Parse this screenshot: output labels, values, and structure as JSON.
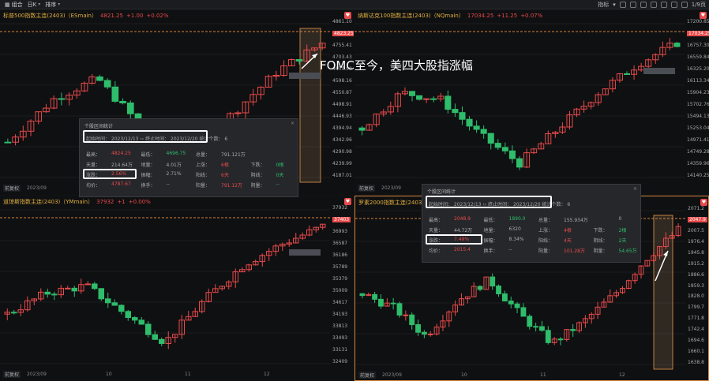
{
  "toolbar": {
    "group": "组合",
    "period": "日K",
    "sort": "排序",
    "indicator": "指标",
    "page": "1/9页"
  },
  "panels": [
    {
      "title": "标普500指数主连(2403)（ESmain）",
      "price": "4821.25",
      "change": "+1.00",
      "pct": "+0.02%",
      "y": [
        "4861.10",
        "4823.25",
        "4755.41",
        "4703.43",
        "4650.90",
        "4598.16",
        "4550.87",
        "4498.91",
        "4446.93",
        "4394.94",
        "4342.96",
        "4290.98",
        "4239.99",
        "4187.01"
      ],
      "fq": "前复权",
      "x": [
        "2023/09"
      ],
      "up": true
    },
    {
      "title": "纳斯达克100指数主连(2403)（NQmain）",
      "price": "17034.25",
      "change": "+11.25",
      "pct": "+0.07%",
      "y": [
        "17200.85",
        "17034.25",
        "16757.30",
        "16559.84",
        "16325.20",
        "16113.34",
        "15904.23",
        "15702.76",
        "15494.13",
        "15253.04",
        "14971.41",
        "14749.28",
        "14359.96",
        "14140.25"
      ],
      "fq": "前复权",
      "x": [
        "2023/09"
      ],
      "up": true
    },
    {
      "title": "道琼斯指数主连(2403)（YMmain）",
      "price": "37932",
      "change": "+1",
      "pct": "+0.00%",
      "y": [
        "37932",
        "37403",
        "36993",
        "36587",
        "36186",
        "35789",
        "35379",
        "35009",
        "34617",
        "34193",
        "33813",
        "33493",
        "33131",
        "32409"
      ],
      "fq": "前复权",
      "x": [
        "2023/09",
        "10",
        "11",
        "12"
      ],
      "up": true
    },
    {
      "title": "罗素2000指数主连(2403)（R",
      "price": "2047.9",
      "change": "",
      "pct": "",
      "y": [
        "2071.2",
        "2047.9",
        "2007.5",
        "1976.4",
        "1945.8",
        "1915.2",
        "1886.6",
        "1859.3",
        "1828.0",
        "1799.7",
        "1771.8",
        "1742.4",
        "1694.6",
        "1660.1",
        "1638.8"
      ],
      "fq": "前复权",
      "x": [
        "2023/09",
        "10",
        "11",
        "12"
      ],
      "up": true
    }
  ],
  "dialogs": [
    {
      "title": "个股区间统计",
      "start_lbl": "起始时间：",
      "start": "2023/12/13",
      "end_lbl": "终止时间：",
      "end": "2023/12/20",
      "count_lbl": "统计个数：",
      "count": "6",
      "r1": [
        "最高：",
        "4824.25",
        "最低：",
        "4696.75",
        "总量：",
        "791.121万",
        "",
        ""
      ],
      "r2": [
        "天量：",
        "214.64万",
        "地量：",
        "4.01万",
        "上涨：",
        "6根",
        "下跌：",
        "0根"
      ],
      "r3": [
        "涨跌：",
        "2.56%",
        "振幅：",
        "2.71%",
        "阳线：",
        "6天",
        "阴线：",
        "0天"
      ],
      "r4": [
        "均价：",
        "4787.67",
        "换手：",
        "--",
        "阳量：",
        "791.12万",
        "阴量：",
        "--"
      ]
    },
    {
      "title": "个股区间统计",
      "start_lbl": "起始时间：",
      "start": "2023/12/13",
      "end_lbl": "终止时间：",
      "end": "2023/12/20",
      "count_lbl": "统计个数：",
      "count": "6",
      "r1": [
        "最高：",
        "2048.9",
        "最低：",
        "1890.0",
        "总量：",
        "155.934万",
        "",
        "0"
      ],
      "r2": [
        "天量：",
        "44.72万",
        "地量：",
        "6320",
        "上涨：",
        "4根",
        "下跌：",
        "2根"
      ],
      "r3": [
        "涨跌：",
        "7.49%",
        "振幅：",
        "8.34%",
        "阳线：",
        "4天",
        "阴线：",
        "2天"
      ],
      "r4": [
        "均价：",
        "2015.4",
        "换手：",
        "--",
        "阳量：",
        "101.28万",
        "阴量：",
        "54.65万"
      ]
    }
  ],
  "annotation": "FOMC至今，美四大股指涨幅",
  "colors": {
    "up": "#e84a4a",
    "down": "#2ebd6b",
    "accent": "#e0b040",
    "bg": "#0f1012"
  }
}
